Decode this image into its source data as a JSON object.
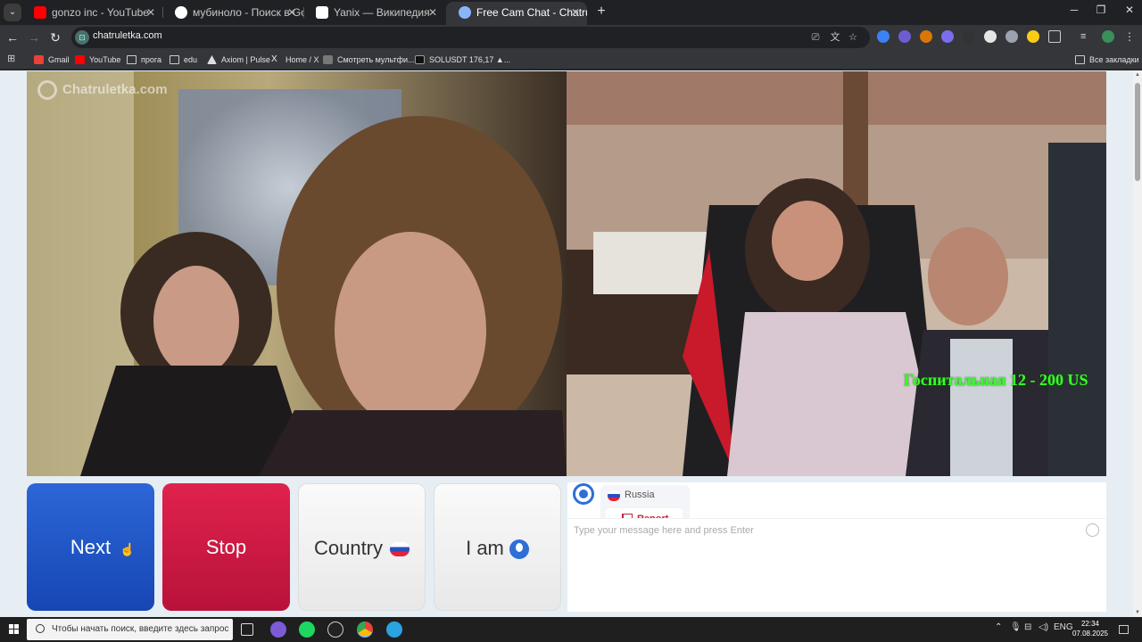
{
  "browser": {
    "tabs": [
      {
        "title": "gonzo inc - YouTube",
        "close": "✕"
      },
      {
        "title": "мубиноло - Поиск в Google",
        "close": "✕"
      },
      {
        "title": "Yanix — Википедия",
        "close": "✕"
      },
      {
        "title": "Free Cam Chat - Chatruletk",
        "close": "✕"
      }
    ],
    "url": "chatruletka.com",
    "bookmarks": [
      "Gmail",
      "YouTube",
      "прога",
      "edu",
      "Axiom | Pulse",
      "Home / X",
      "Смотреть мультфи...",
      "SOLUSDT 176,17 ▲...",
      "Все закладки"
    ]
  },
  "page": {
    "watermark": "Chatruletka.com",
    "overlay_text": "Госпитальная 12 - 200 US",
    "buttons": {
      "next": "Next",
      "stop": "Stop",
      "country": "Country",
      "iam": "I am"
    },
    "chat": {
      "partner_country": "Russia",
      "report_label": "Report",
      "input_placeholder": "Type your message here and press Enter"
    }
  },
  "taskbar": {
    "search_placeholder": "Чтобы начать поиск, введите здесь запрос",
    "language": "ENG",
    "time": "22:34",
    "date": "07.08.2025"
  },
  "colors": {
    "next": "#1f55c6",
    "stop": "#d0183f",
    "accent": "#2e6fd6",
    "overlay_green": "#39ff2a"
  }
}
